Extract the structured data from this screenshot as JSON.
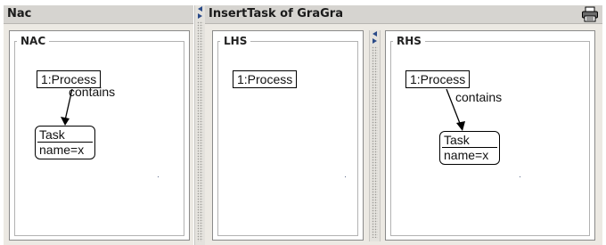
{
  "nac_pane": {
    "title": "Nac",
    "panel_label": "NAC"
  },
  "rule_pane": {
    "title": "InsertTask  of  GraGra"
  },
  "lhs": {
    "panel_label": "LHS"
  },
  "rhs": {
    "panel_label": "RHS"
  },
  "nodes": {
    "process": "1:Process",
    "task": "Task",
    "task_attr": "name=x"
  },
  "edge_label": "contains",
  "icons": {
    "print": "printer-icon",
    "split": "split-arrows-icon"
  }
}
